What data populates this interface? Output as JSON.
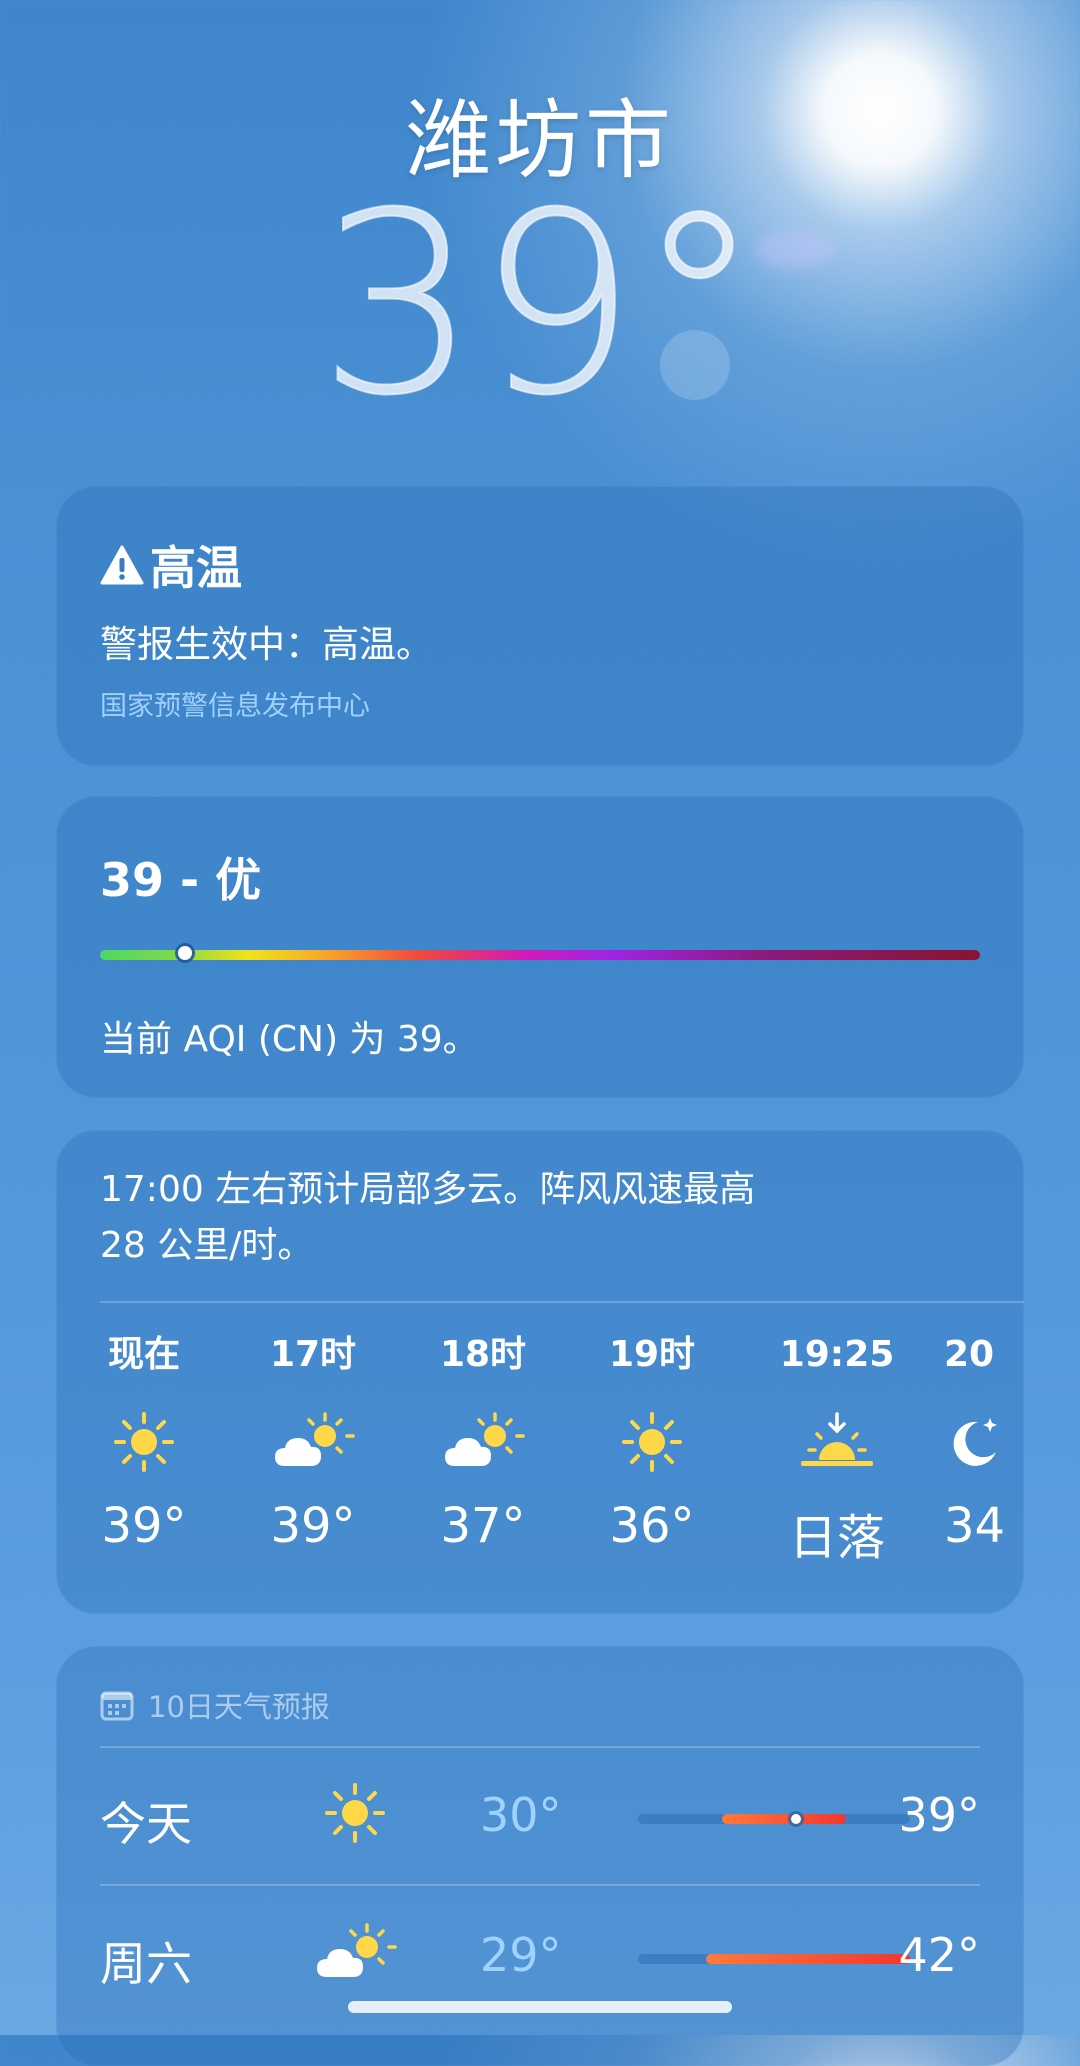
{
  "location": {
    "city": "潍坊市",
    "temperature": "39°"
  },
  "alert": {
    "title": "高温",
    "message": "警报生效中：高温。",
    "source": "国家预警信息发布中心",
    "icon": "warning-triangle-icon"
  },
  "aqi": {
    "value_label": "39 - 优",
    "value": 39,
    "description": "当前 AQI (CN) 为 39。"
  },
  "hourly": {
    "summary_line1": "17:00 左右预计局部多云。阵风风速最高",
    "summary_line2": "28 公里/时。",
    "items": [
      {
        "label": "现在",
        "icon": "sun-icon",
        "temp": "39°"
      },
      {
        "label": "17时",
        "icon": "partly-cloudy-icon",
        "temp": "39°"
      },
      {
        "label": "18时",
        "icon": "partly-cloudy-icon",
        "temp": "37°"
      },
      {
        "label": "19时",
        "icon": "sun-icon",
        "temp": "36°"
      },
      {
        "label": "19:25",
        "icon": "sunset-icon",
        "temp": "日落"
      },
      {
        "label": "20",
        "icon": "moon-icon",
        "temp": "34"
      }
    ]
  },
  "ten_day": {
    "header": "10日天气预报",
    "days": [
      {
        "name": "今天",
        "icon": "sun-icon",
        "low": "30°",
        "high": "39°",
        "current": 0.58
      },
      {
        "name": "周六",
        "icon": "partly-cloudy-icon",
        "low": "29°",
        "high": "42°"
      }
    ]
  }
}
